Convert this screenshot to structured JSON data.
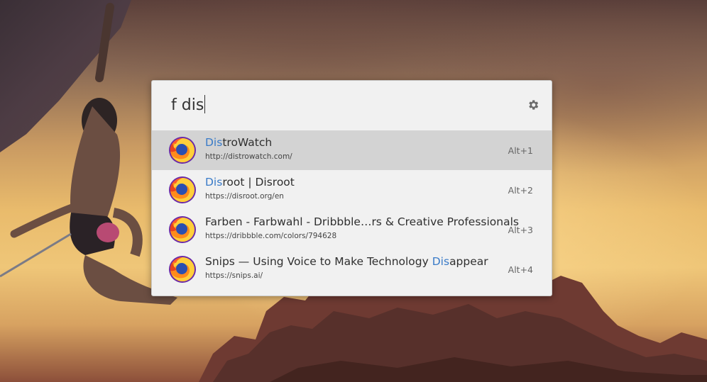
{
  "launcher": {
    "query": "f dis",
    "results": [
      {
        "title_highlight": "Dis",
        "title_rest": "troWatch",
        "title_prefix": "",
        "url": "http://distrowatch.com/",
        "shortcut": "Alt+1",
        "selected": true,
        "icon": "firefox-icon"
      },
      {
        "title_highlight": "Dis",
        "title_rest": "root | Disroot",
        "title_prefix": "",
        "url": "https://disroot.org/en",
        "shortcut": "Alt+2",
        "selected": false,
        "icon": "firefox-icon"
      },
      {
        "title_prefix": "Farben - Farbwahl - Dribbble…rs & Creative Professionals",
        "title_highlight": "",
        "title_rest": "",
        "url": "https://dribbble.com/colors/794628",
        "shortcut": "Alt+3",
        "selected": false,
        "icon": "firefox-icon"
      },
      {
        "title_prefix": "Snips — Using Voice to Make Technology ",
        "title_highlight": "Dis",
        "title_rest": "appear",
        "url": "https://snips.ai/",
        "shortcut": "Alt+4",
        "selected": false,
        "icon": "firefox-icon"
      }
    ],
    "settings_icon": "gear-icon",
    "colors": {
      "highlight": "#3a7bc8",
      "selected_bg": "#d3d3d3",
      "panel_bg": "#f1f1f1"
    }
  }
}
